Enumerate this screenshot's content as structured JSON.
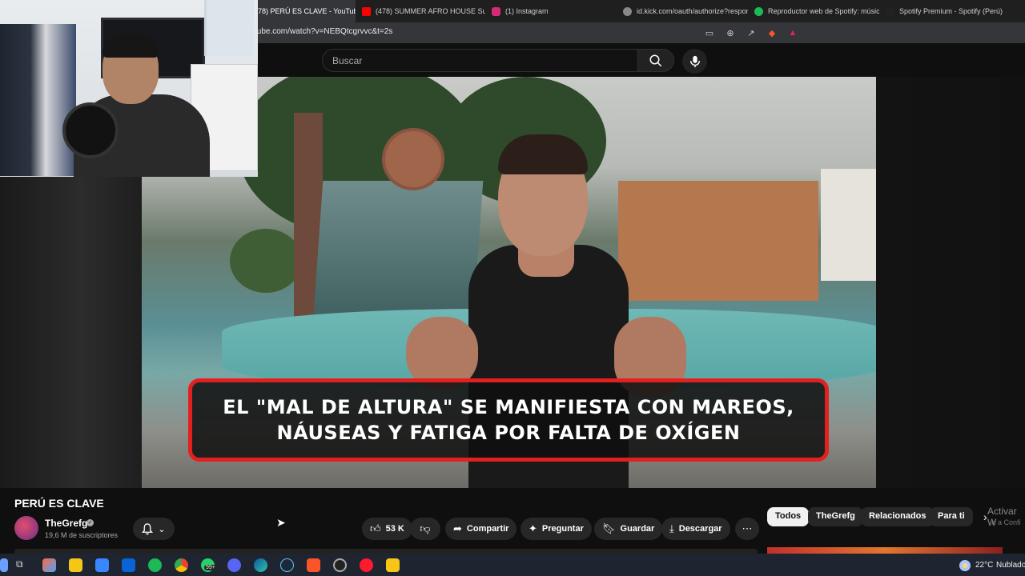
{
  "browser": {
    "tabs": [
      {
        "title": "78) PERÚ ES CLAVE - YouTub",
        "favicon_color": "#ff0000",
        "active": true,
        "close": "×"
      },
      {
        "title": "(478) SUMMER AFRO HOUSE Sunset",
        "favicon_color": "#ff0000"
      },
      {
        "title": "(1) Instagram",
        "favicon_color": "#d62976"
      },
      {
        "title": "id.kick.com/oauth/authorize?respons",
        "favicon_color": "#888888"
      },
      {
        "title": "Reproductor web de Spotify: música",
        "favicon_color": "#1db954"
      },
      {
        "title": "Spotify Premium - Spotify (Perú)",
        "favicon_color": "#222222"
      }
    ],
    "url": "tube.com/watch?v=NEBQtcgrvvc&t=2s"
  },
  "youtube": {
    "search_placeholder": "Buscar",
    "caption_line1": "EL \"MAL DE ALTURA\" SE MANIFIESTA CON MAREOS,",
    "caption_line2": "NÁUSEAS Y FATIGA POR FALTA DE OXÍGEN",
    "video_title": "PERÚ ES CLAVE",
    "channel_name": "TheGrefg",
    "subscribers": "19,6 M de suscriptores",
    "likes": "53 K",
    "actions": {
      "share": "Compartir",
      "ask": "Preguntar",
      "save": "Guardar",
      "download": "Descargar"
    },
    "chips": [
      "Todos",
      "TheGrefg",
      "Relacionados",
      "Para ti"
    ],
    "activate_windows": "Activar W",
    "activate_windows_sub": "Ve a Confi"
  },
  "taskbar": {
    "notif_badge": "99+",
    "temperature": "22°C",
    "weather": "Nublado"
  }
}
